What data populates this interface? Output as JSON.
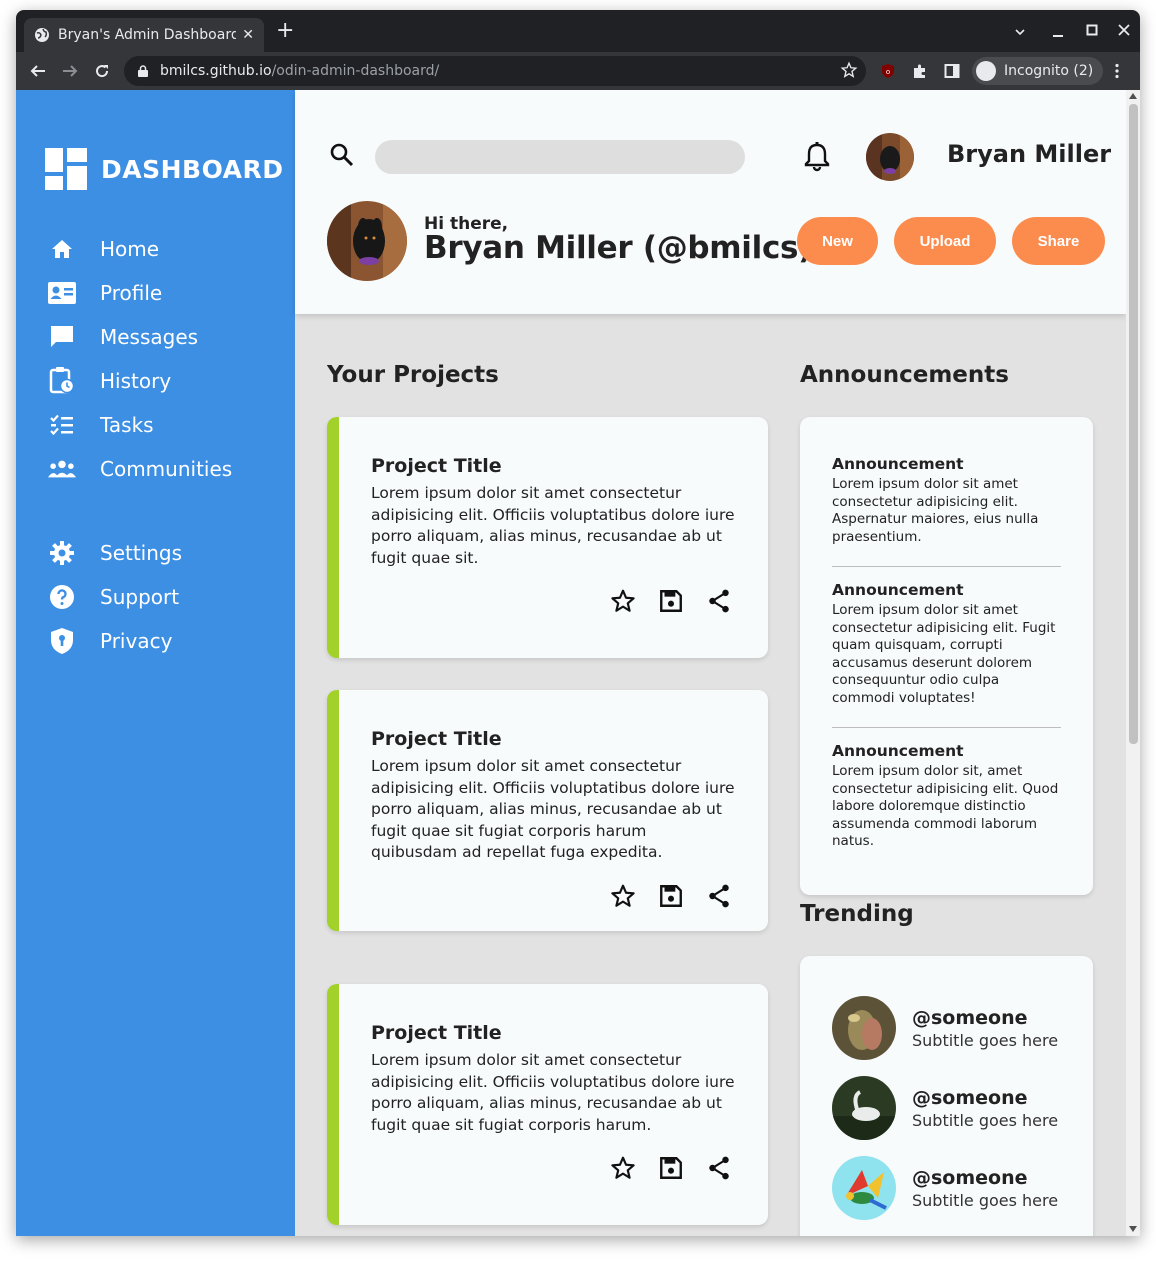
{
  "browser": {
    "tab_title": "Bryan's Admin Dashboard",
    "tab_close": "✕",
    "new_tab": "+",
    "url_host": "bmilcs.github.io",
    "url_path": "/odin-admin-dashboard/",
    "profile_label": "Incognito (2)"
  },
  "sidebar": {
    "brand": "DASHBOARD",
    "items": [
      {
        "label": "Home",
        "icon": "home-icon"
      },
      {
        "label": "Profile",
        "icon": "profile-card-icon"
      },
      {
        "label": "Messages",
        "icon": "message-icon"
      },
      {
        "label": "History",
        "icon": "history-icon"
      },
      {
        "label": "Tasks",
        "icon": "tasks-icon"
      },
      {
        "label": "Communities",
        "icon": "communities-icon"
      },
      {
        "label": "Settings",
        "icon": "gear-icon"
      },
      {
        "label": "Support",
        "icon": "help-icon"
      },
      {
        "label": "Privacy",
        "icon": "shield-icon"
      }
    ]
  },
  "header": {
    "search_placeholder": "",
    "user_name": "Bryan Miller",
    "greeting": "Hi there,",
    "greeting_name": "Bryan Miller (@bmilcs)",
    "buttons": {
      "new": "New",
      "upload": "Upload",
      "share": "Share"
    }
  },
  "projects": {
    "title": "Your Projects",
    "items": [
      {
        "title": "Project Title",
        "body": "Lorem ipsum dolor sit amet consectetur adipisicing elit. Officiis voluptatibus dolore iure porro aliquam, alias minus, recusandae ab ut fugit quae sit."
      },
      {
        "title": "Project Title",
        "body": "Lorem ipsum dolor sit amet consectetur adipisicing elit. Officiis voluptatibus dolore iure porro aliquam, alias minus, recusandae ab ut fugit quae sit fugiat corporis harum quibusdam ad repellat fuga expedita."
      },
      {
        "title": "Project Title",
        "body": "Lorem ipsum dolor sit amet consectetur adipisicing elit. Officiis voluptatibus dolore iure porro aliquam, alias minus, recusandae ab ut fugit quae sit fugiat corporis harum."
      }
    ]
  },
  "announcements": {
    "title": "Announcements",
    "items": [
      {
        "title": "Announcement",
        "body": "Lorem ipsum dolor sit amet consectetur adipisicing elit. Aspernatur maiores, eius nulla praesentium."
      },
      {
        "title": "Announcement",
        "body": "Lorem ipsum dolor sit amet consectetur adipisicing elit. Fugit quam quisquam, corrupti accusamus deserunt dolorem consequuntur odio culpa commodi voluptates!"
      },
      {
        "title": "Announcement",
        "body": "Lorem ipsum dolor sit, amet consectetur adipisicing elit. Quod labore doloremque distinctio assumenda commodi laborum natus."
      }
    ]
  },
  "trending": {
    "title": "Trending",
    "items": [
      {
        "name": "@someone",
        "subtitle": "Subtitle goes here"
      },
      {
        "name": "@someone",
        "subtitle": "Subtitle goes here"
      },
      {
        "name": "@someone",
        "subtitle": "Subtitle goes here"
      }
    ]
  },
  "colors": {
    "sidebar": "#3d8fe4",
    "accent_button": "#fb8c4d",
    "project_stripe": "#a2d12a",
    "main_bg": "#e2e2e2"
  }
}
